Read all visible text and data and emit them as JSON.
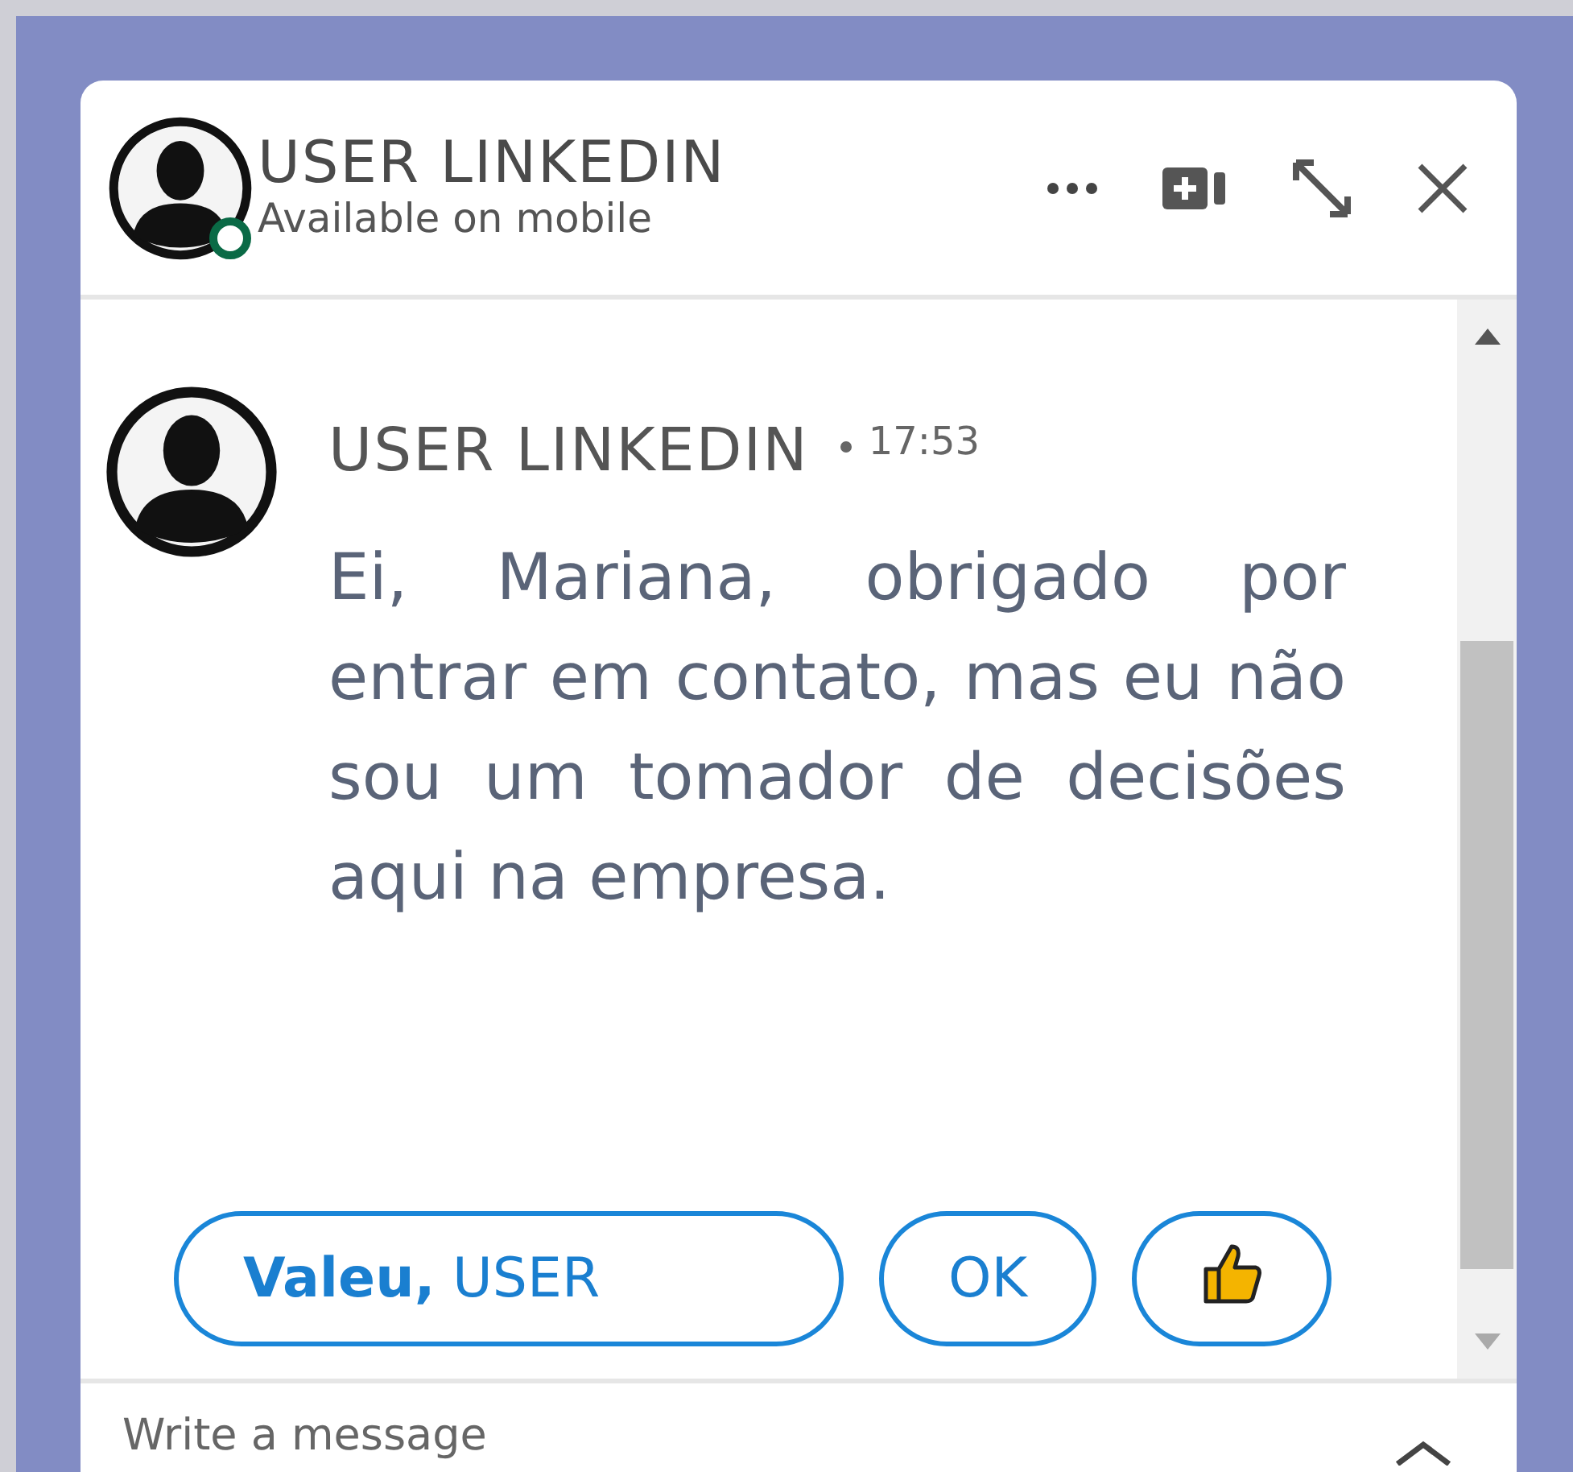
{
  "header": {
    "name": "USER LINKEDIN",
    "status": "Available on mobile",
    "online": true
  },
  "message": {
    "sender": "USER LINKEDIN",
    "time": "17:53",
    "text": "Ei, Mariana, obrigado por entrar em contato, mas eu não sou um tomador de decisões aqui na empresa."
  },
  "suggested_replies": [
    {
      "kind": "text",
      "label": "**Valeu,** USER"
    },
    {
      "kind": "text",
      "label": "OK"
    },
    {
      "kind": "thumb"
    }
  ],
  "composer": {
    "placeholder": "Write a message"
  }
}
